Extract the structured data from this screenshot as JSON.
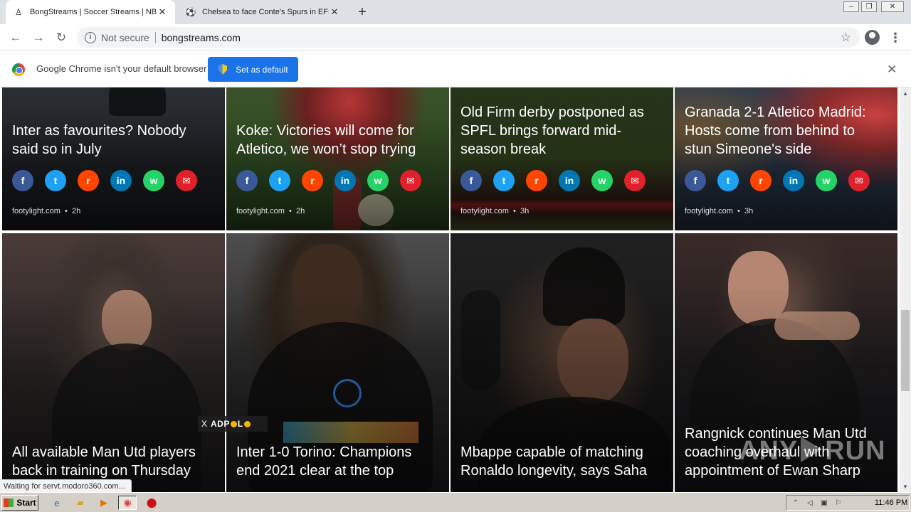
{
  "browser": {
    "tabs": [
      {
        "title": "BongStreams | Soccer Streams | NBA",
        "icon": "bong-favicon-icon",
        "active": true
      },
      {
        "title": "Chelsea to face Conte's Spurs in EFL",
        "icon": "green-player-favicon-icon",
        "active": false
      }
    ],
    "new_tab_label": "+",
    "address": {
      "security": "Not secure",
      "url": "bongstreams.com"
    },
    "infobar": {
      "message": "Google Chrome isn't your default browser",
      "button": "Set as default"
    },
    "status_text": "Waiting for servt.modoro360.com..."
  },
  "share_icons": [
    "f",
    "t",
    "r",
    "in",
    "w",
    "✉"
  ],
  "cards": [
    {
      "headline_lines": [
        "Inter as favourites? Nobody",
        "said so in July"
      ],
      "source": "footylight.com",
      "age": "2h"
    },
    {
      "headline_lines": [
        "Koke: Victories will come for",
        "Atletico, we won’t stop trying"
      ],
      "source": "footylight.com",
      "age": "2h"
    },
    {
      "headline_lines": [
        "Old Firm derby postponed as",
        "SPFL brings forward mid-",
        "season break"
      ],
      "source": "footylight.com",
      "age": "3h"
    },
    {
      "headline_lines": [
        "Granada 2-1 Atletico Madrid:",
        "Hosts come from behind to",
        "stun Simeone's side"
      ],
      "source": "footylight.com",
      "age": "3h"
    },
    {
      "headline_lines": [
        "All available Man Utd players",
        "back in training on Thursday"
      ]
    },
    {
      "headline_lines": [
        "Inter 1-0 Torino: Champions",
        "end 2021 clear at the top"
      ]
    },
    {
      "headline_lines": [
        "Mbappe capable of matching",
        "Ronaldo longevity, says Saha"
      ]
    },
    {
      "headline_lines": [
        "Rangnick continues Man Utd",
        "coaching overhaul with",
        "appointment of Ewan Sharp"
      ]
    }
  ],
  "ad": {
    "close": "X",
    "brand_a": "ADP",
    "brand_b": "L",
    "brand_c": "L"
  },
  "watermark": {
    "left": "ANY",
    "right": "RUN"
  },
  "taskbar": {
    "start_label": "Start",
    "clock": "11:46 PM"
  },
  "colors": {
    "chrome_blue": "#1a73e8",
    "facebook": "#3b5998",
    "twitter": "#1da1f2",
    "reddit": "#ff4500",
    "linkedin": "#0077b5",
    "whatsapp": "#25d366",
    "email": "#e0202a"
  }
}
